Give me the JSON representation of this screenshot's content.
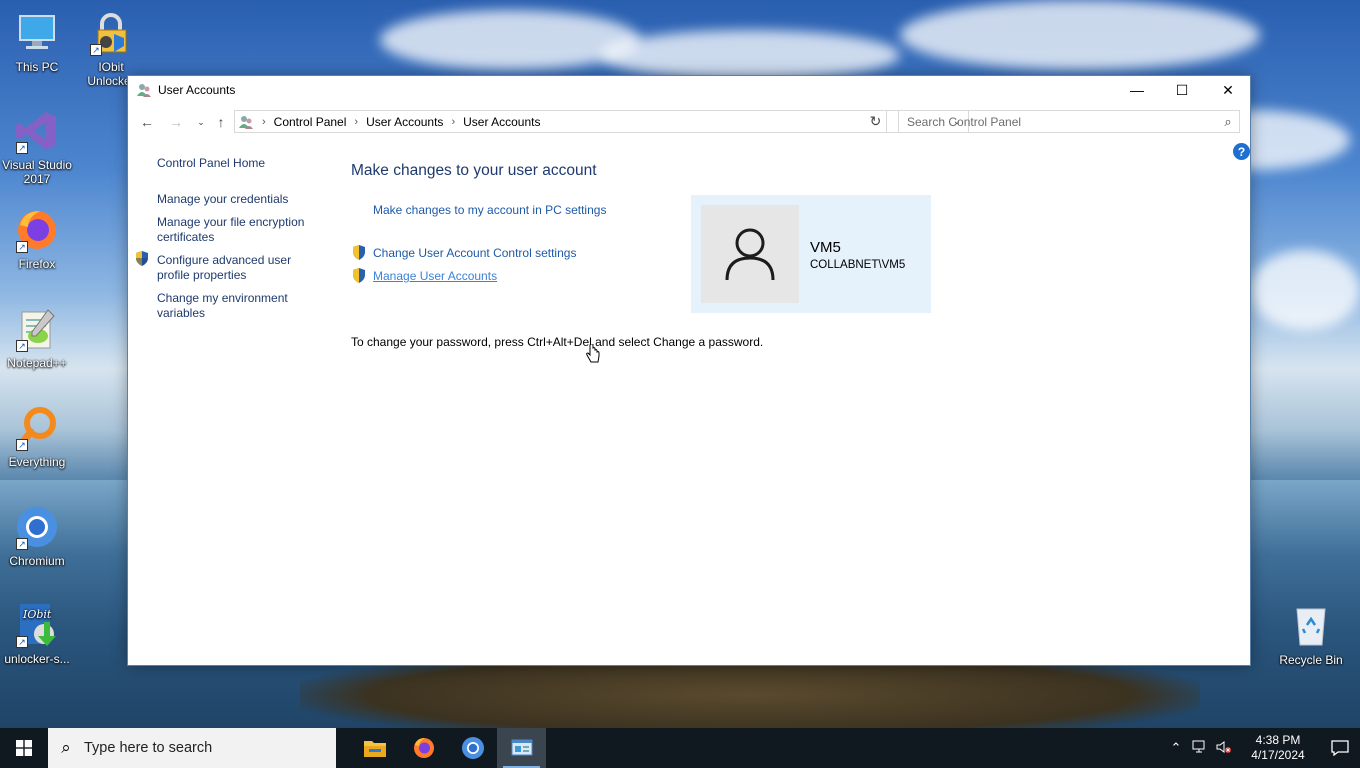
{
  "desktop": {
    "icons": [
      {
        "label": "This PC"
      },
      {
        "label": "IObit Unlocker"
      },
      {
        "label": "Visual Studio 2017"
      },
      {
        "label": "Firefox"
      },
      {
        "label": "Notepad++"
      },
      {
        "label": "Everything"
      },
      {
        "label": "Chromium"
      },
      {
        "label": "unlocker-s..."
      },
      {
        "label": "Recycle Bin"
      }
    ]
  },
  "window": {
    "title": "User Accounts",
    "controls": {
      "minimize": "—",
      "maximize": "☐",
      "close": "✕"
    },
    "breadcrumb": [
      "Control Panel",
      "User Accounts",
      "User Accounts"
    ],
    "search_placeholder": "Search Control Panel",
    "help_label": "?",
    "left_pane": {
      "home": "Control Panel Home",
      "links": [
        "Manage your credentials",
        "Manage your file encryption certificates",
        "Configure advanced user profile properties",
        "Change my environment variables"
      ]
    },
    "main": {
      "heading": "Make changes to your user account",
      "tasks": [
        "Make changes to my account in PC settings",
        "Change User Account Control settings",
        "Manage User Accounts"
      ],
      "password_note": "To change your password, press Ctrl+Alt+Del and select Change a password.",
      "account": {
        "name": "VM5",
        "domain": "COLLABNET\\VM5"
      }
    }
  },
  "taskbar": {
    "search_placeholder": "Type here to search",
    "apps": [
      "File Explorer",
      "Firefox",
      "Chromium",
      "Control Panel"
    ],
    "clock": {
      "time": "4:38 PM",
      "date": "4/17/2024"
    }
  }
}
